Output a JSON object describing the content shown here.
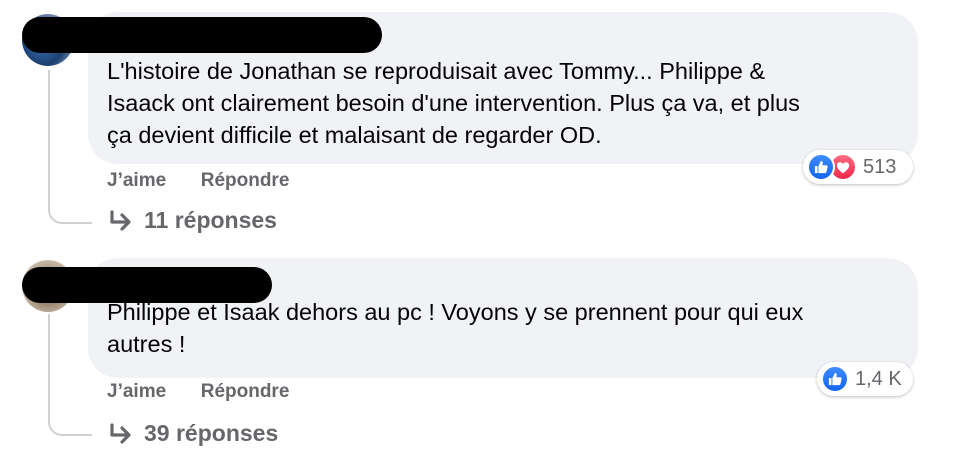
{
  "comments": [
    {
      "text": "L'histoire de Jonathan se reproduisait avec Tommy... Philippe &\nIsaack ont clairement besoin d'une intervention. Plus ça va, et plus\nça devient difficile et malaisant de regarder OD.",
      "reaction_count": "513",
      "reaction_icons": [
        "like-icon",
        "love-icon"
      ],
      "like_label": "J’aime",
      "reply_label": "Répondre",
      "replies_label": "11 réponses"
    },
    {
      "text": "Philippe et Isaak dehors au pc ! Voyons y se prennent pour qui eux\nautres !",
      "reaction_count": "1,4 K",
      "reaction_icons": [
        "like-icon"
      ],
      "like_label": "J’aime",
      "reply_label": "Répondre",
      "replies_label": "39 réponses"
    }
  ],
  "colors": {
    "bubble": "#f0f2f5",
    "meta_text": "#65676b",
    "like_blue": "#1877f2",
    "love_red": "#f02849",
    "redaction": "#000000"
  }
}
